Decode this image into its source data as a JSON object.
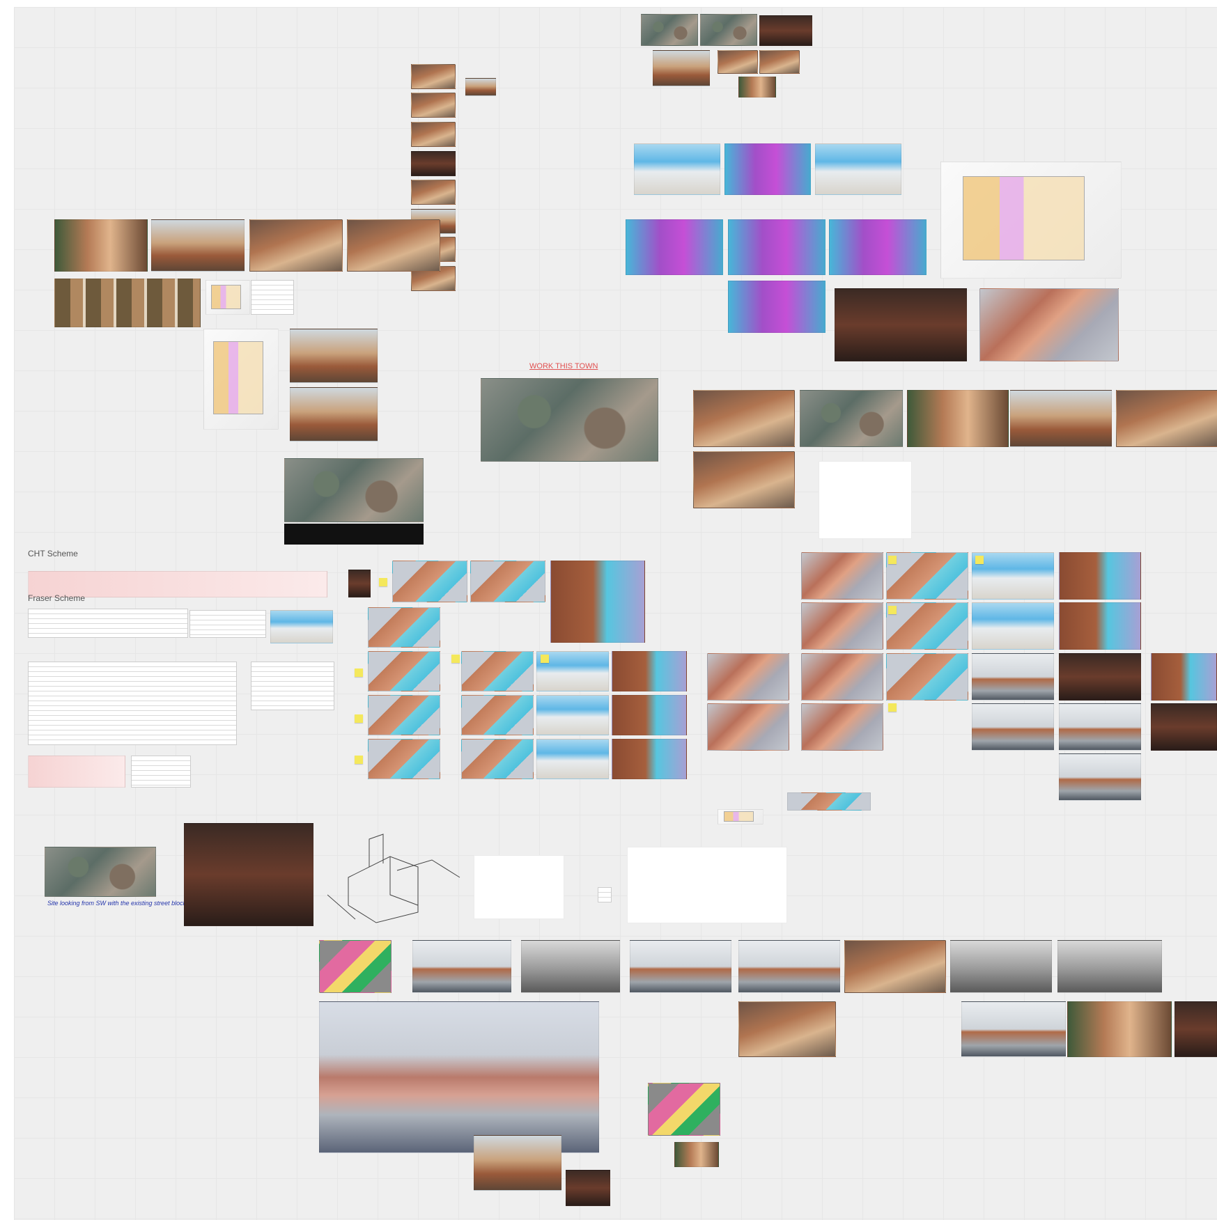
{
  "board": {
    "label_cht": "CHT Scheme",
    "label_fraser": "Fraser Scheme",
    "label_redlink": "WORK THIS TOWN",
    "label_handnote": "Site looking from SW with the existing street block"
  },
  "icons": [
    "sticky-note-icon"
  ]
}
